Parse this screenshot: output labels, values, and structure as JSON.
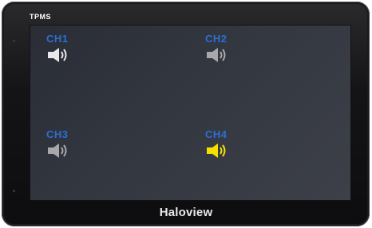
{
  "app": {
    "title": "TPMS",
    "brand": "Haloview"
  },
  "channels": [
    {
      "label": "CH1",
      "icon": "speaker-icon",
      "label_color": "#2a6fd6",
      "icon_color": "#e8e8e8"
    },
    {
      "label": "CH2",
      "icon": "speaker-icon",
      "label_color": "#2a6fd6",
      "icon_color": "#a8a8aa"
    },
    {
      "label": "CH3",
      "icon": "speaker-icon",
      "label_color": "#2a6fd6",
      "icon_color": "#a8a8aa"
    },
    {
      "label": "CH4",
      "icon": "speaker-icon",
      "label_color": "#2a6fd6",
      "icon_color": "#f5e000"
    }
  ],
  "colors": {
    "bezel": "#141416",
    "screen": "#343841",
    "accent_blue": "#2a6fd6",
    "active_yellow": "#f5e000"
  }
}
